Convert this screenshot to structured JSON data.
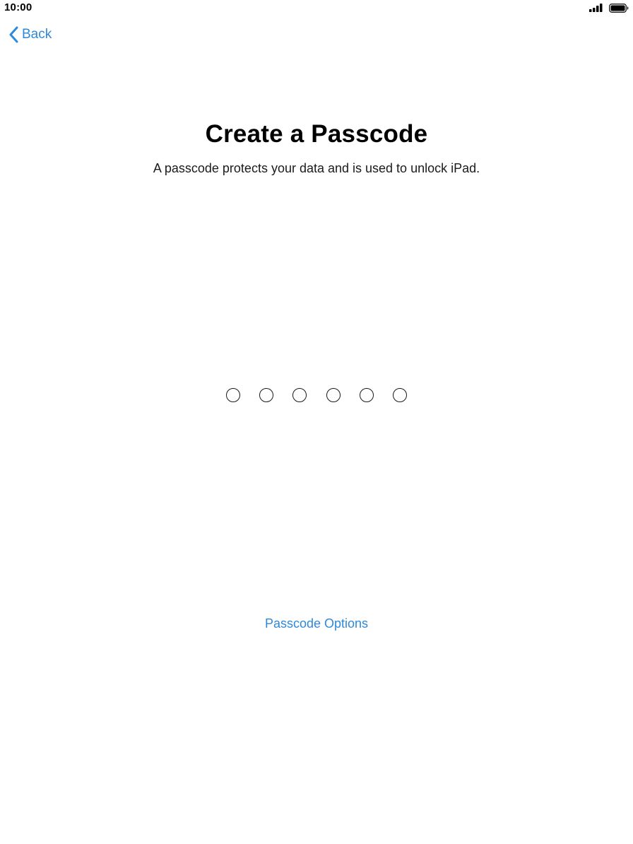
{
  "status_bar": {
    "time": "10:00",
    "signal_icon": "cellular-signal-icon",
    "battery_icon": "battery-icon"
  },
  "nav": {
    "back_label": "Back",
    "back_icon": "chevron-left-icon"
  },
  "main": {
    "title": "Create a Passcode",
    "subtitle": "A passcode protects your data and is used to unlock iPad.",
    "passcode_length": 6,
    "digits_entered": 0
  },
  "options": {
    "label": "Passcode Options"
  },
  "colors": {
    "accent": "#2e89d9",
    "text": "#000000",
    "background": "#ffffff"
  }
}
